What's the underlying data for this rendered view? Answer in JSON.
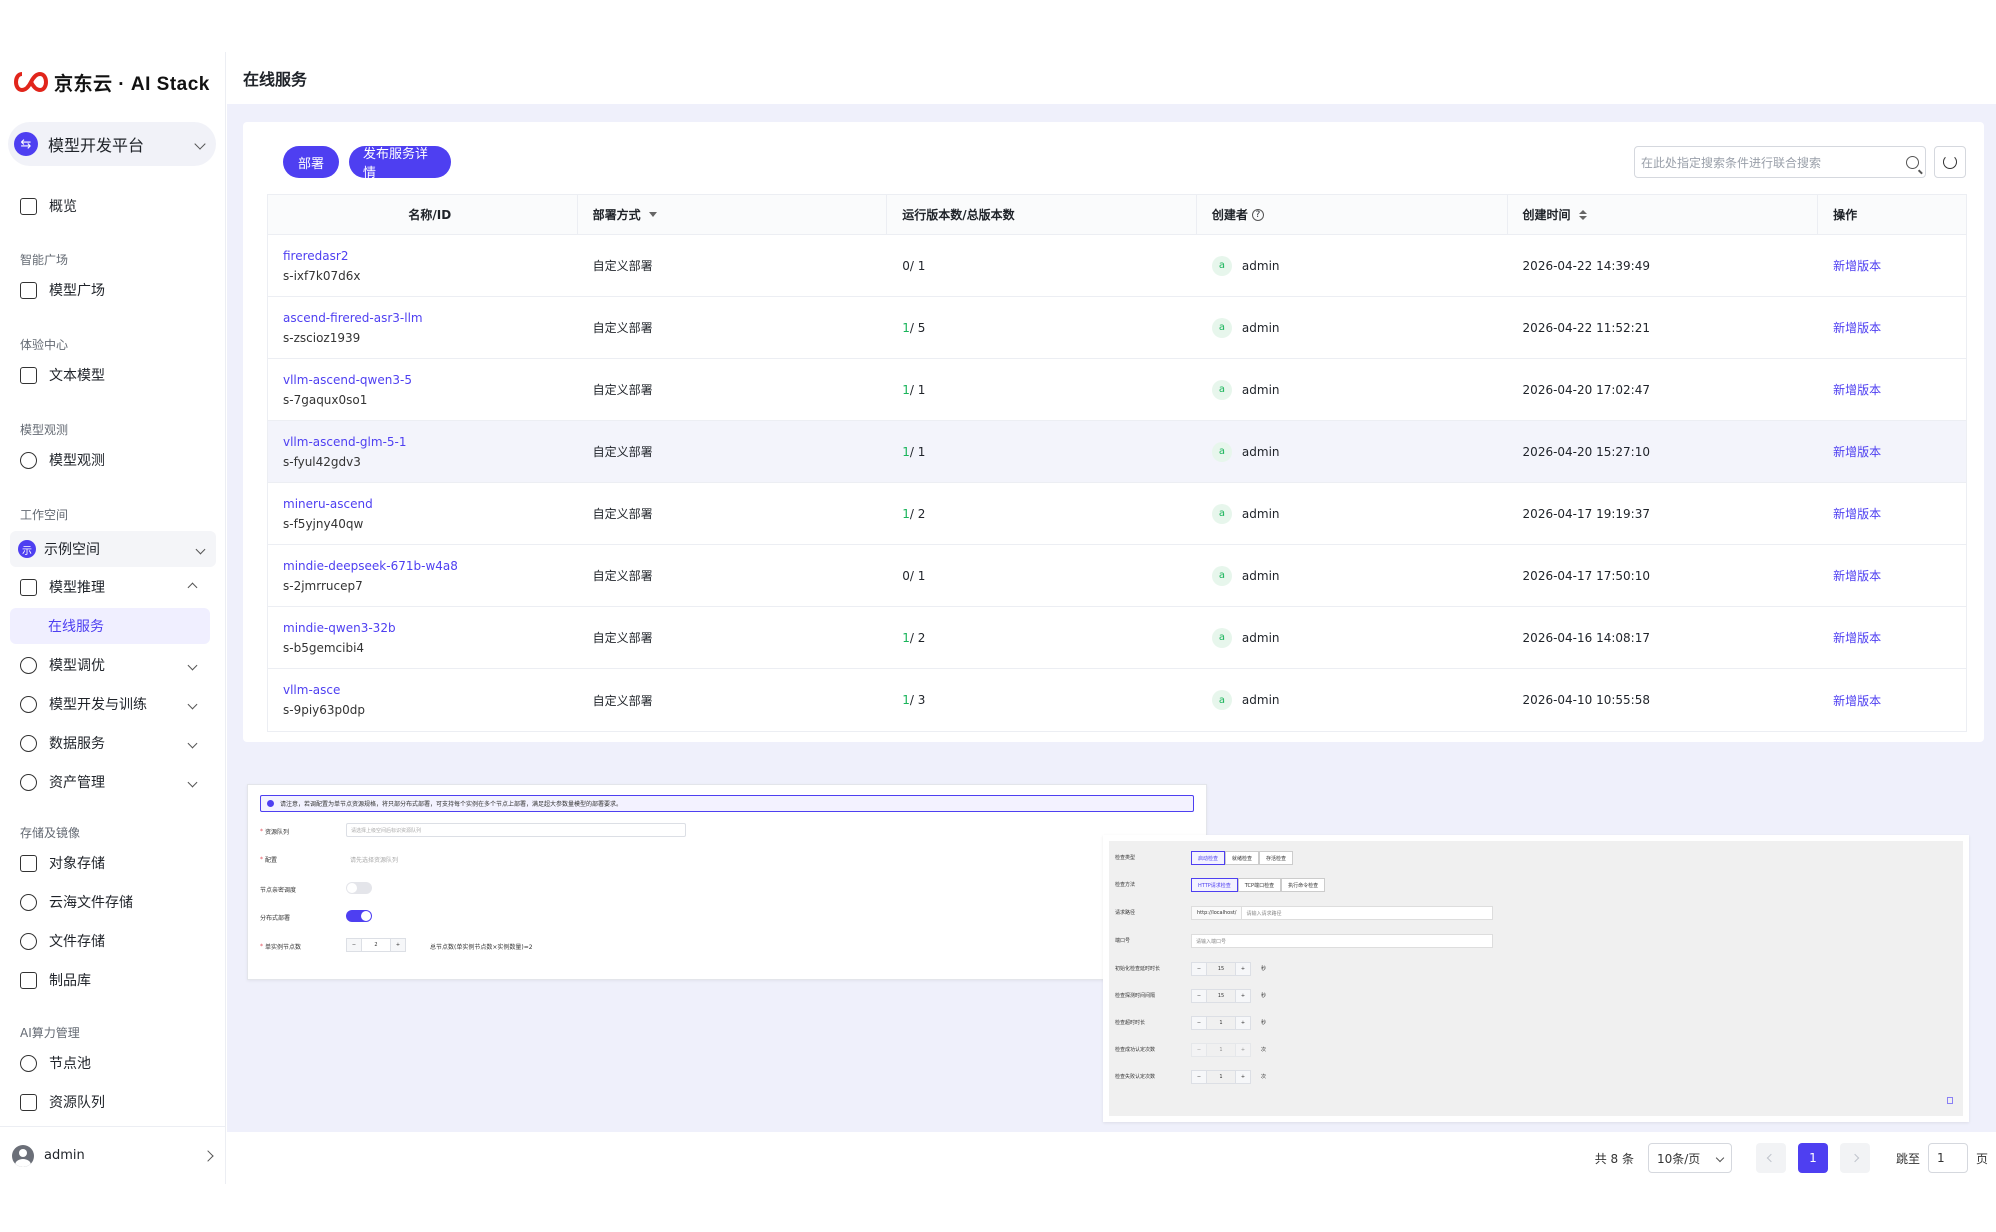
{
  "brand": {
    "logo_text": "京东云 · AI Stack"
  },
  "sidebar": {
    "platform_label": "模型开发平台",
    "groups": {
      "overview": "概览",
      "g_smart": "智能广场",
      "model_square": "模型广场",
      "g_experience": "体验中心",
      "text_model": "文本模型",
      "g_observe": "模型观测",
      "model_observe": "模型观测",
      "g_workspace": "工作空间",
      "workspace": "示例空间",
      "workspace_icon": "示",
      "model_inference": "模型推理",
      "online_service": "在线服务",
      "model_tuning": "模型调优",
      "model_dev": "模型开发与训练",
      "data_service": "数据服务",
      "asset_mgmt": "资产管理",
      "g_storage": "存储及镜像",
      "object_storage": "对象存储",
      "cloud_file": "云海文件存储",
      "file_storage": "文件存储",
      "artifact": "制品库",
      "g_compute": "AI算力管理",
      "node_pool": "节点池",
      "resource_queue": "资源队列"
    },
    "user": "admin"
  },
  "header": {
    "title": "在线服务"
  },
  "toolbar": {
    "deploy": "部署",
    "publish_detail": "发布服务详情",
    "search_placeholder": "在此处指定搜索条件进行联合搜索"
  },
  "table": {
    "columns": [
      "名称/ID",
      "部署方式",
      "运行版本数/总版本数",
      "创建者",
      "创建时间",
      "操作"
    ],
    "rows": [
      {
        "name": "fireredasr2",
        "id": "s-ixf7k07d6x",
        "deploy": "自定义部署",
        "run": "0",
        "total": " / 1",
        "creator_initial": "a",
        "creator": "admin",
        "time": "2026-04-22 14:39:49",
        "action": "新增版本"
      },
      {
        "name": "ascend-firered-asr3-llm",
        "id": "s-zscioz1939",
        "deploy": "自定义部署",
        "run": "1",
        "total": " / 5",
        "creator_initial": "a",
        "creator": "admin",
        "time": "2026-04-22 11:52:21",
        "action": "新增版本"
      },
      {
        "name": "vllm-ascend-qwen3-5",
        "id": "s-7gaqux0so1",
        "deploy": "自定义部署",
        "run": "1",
        "total": " / 1",
        "creator_initial": "a",
        "creator": "admin",
        "time": "2026-04-20 17:02:47",
        "action": "新增版本"
      },
      {
        "name": "vllm-ascend-glm-5-1",
        "id": "s-fyul42gdv3",
        "deploy": "自定义部署",
        "run": "1",
        "total": " / 1",
        "creator_initial": "a",
        "creator": "admin",
        "time": "2026-04-20 15:27:10",
        "action": "新增版本"
      },
      {
        "name": "mineru-ascend",
        "id": "s-f5yjny40qw",
        "deploy": "自定义部署",
        "run": "1",
        "total": " / 2",
        "creator_initial": "a",
        "creator": "admin",
        "time": "2026-04-17 19:19:37",
        "action": "新增版本"
      },
      {
        "name": "mindie-deepseek-671b-w4a8",
        "id": "s-2jmrrucep7",
        "deploy": "自定义部署",
        "run": "0",
        "total": " / 1",
        "creator_initial": "a",
        "creator": "admin",
        "time": "2026-04-17 17:50:10",
        "action": "新增版本"
      },
      {
        "name": "mindie-qwen3-32b",
        "id": "s-b5gemcibi4",
        "deploy": "自定义部署",
        "run": "1",
        "total": " / 2",
        "creator_initial": "a",
        "creator": "admin",
        "time": "2026-04-16 14:08:17",
        "action": "新增版本"
      },
      {
        "name": "vllm-asce",
        "id": "s-9piy63p0dp",
        "deploy": "自定义部署",
        "run": "1",
        "total": " / 3",
        "creator_initial": "a",
        "creator": "admin",
        "time": "2026-04-10 10:55:58",
        "action": "新增版本"
      }
    ]
  },
  "panel_a": {
    "notice": "请注意，若调配置为单节点资源规格，将只部分布式部署，可支持每个实例在多个节点上部署，满足超大参数量模型的部署要求。",
    "queue_label": "资源队列",
    "queue_placeholder": "请选择上级空间后标识资源队列",
    "spec_label": "配置",
    "spec_placeholder": "请先选择资源队列",
    "affinity_label": "节点亲密调度",
    "distributed_label": "分布式部署",
    "nodes_label": "单实例节点数",
    "nodes_value": "2",
    "nodes_hint": "总节点数(单实例节点数×实例数量)=2"
  },
  "panel_b": {
    "check_type_label": "检查类型",
    "check_types": [
      "启动检查",
      "就绪检查",
      "存活检查"
    ],
    "check_method_label": "检查方法",
    "check_methods": [
      "HTTP请求检查",
      "TCP端口检查",
      "执行命令检查"
    ],
    "path_label": "请求路径",
    "path_prefix": "http://localhost/",
    "path_placeholder": "请输入请求路径",
    "port_label": "端口号",
    "port_placeholder": "请输入端口号",
    "delay_label": "初始化检查延时时长",
    "delay_value": "15",
    "interval_label": "检查探测时间间隔",
    "interval_value": "15",
    "timeout_label": "检查超时时长",
    "timeout_value": "1",
    "success_label": "检查成功认定次数",
    "success_value": "1",
    "fail_label": "检查失败认定次数",
    "fail_value": "1",
    "unit_s": "秒",
    "unit_times": "次"
  },
  "pagination": {
    "total": "共 8 条",
    "page_size": "10条/页",
    "current": "1",
    "jump_label": "跳至",
    "jump_value": "1",
    "page_unit": "页"
  }
}
